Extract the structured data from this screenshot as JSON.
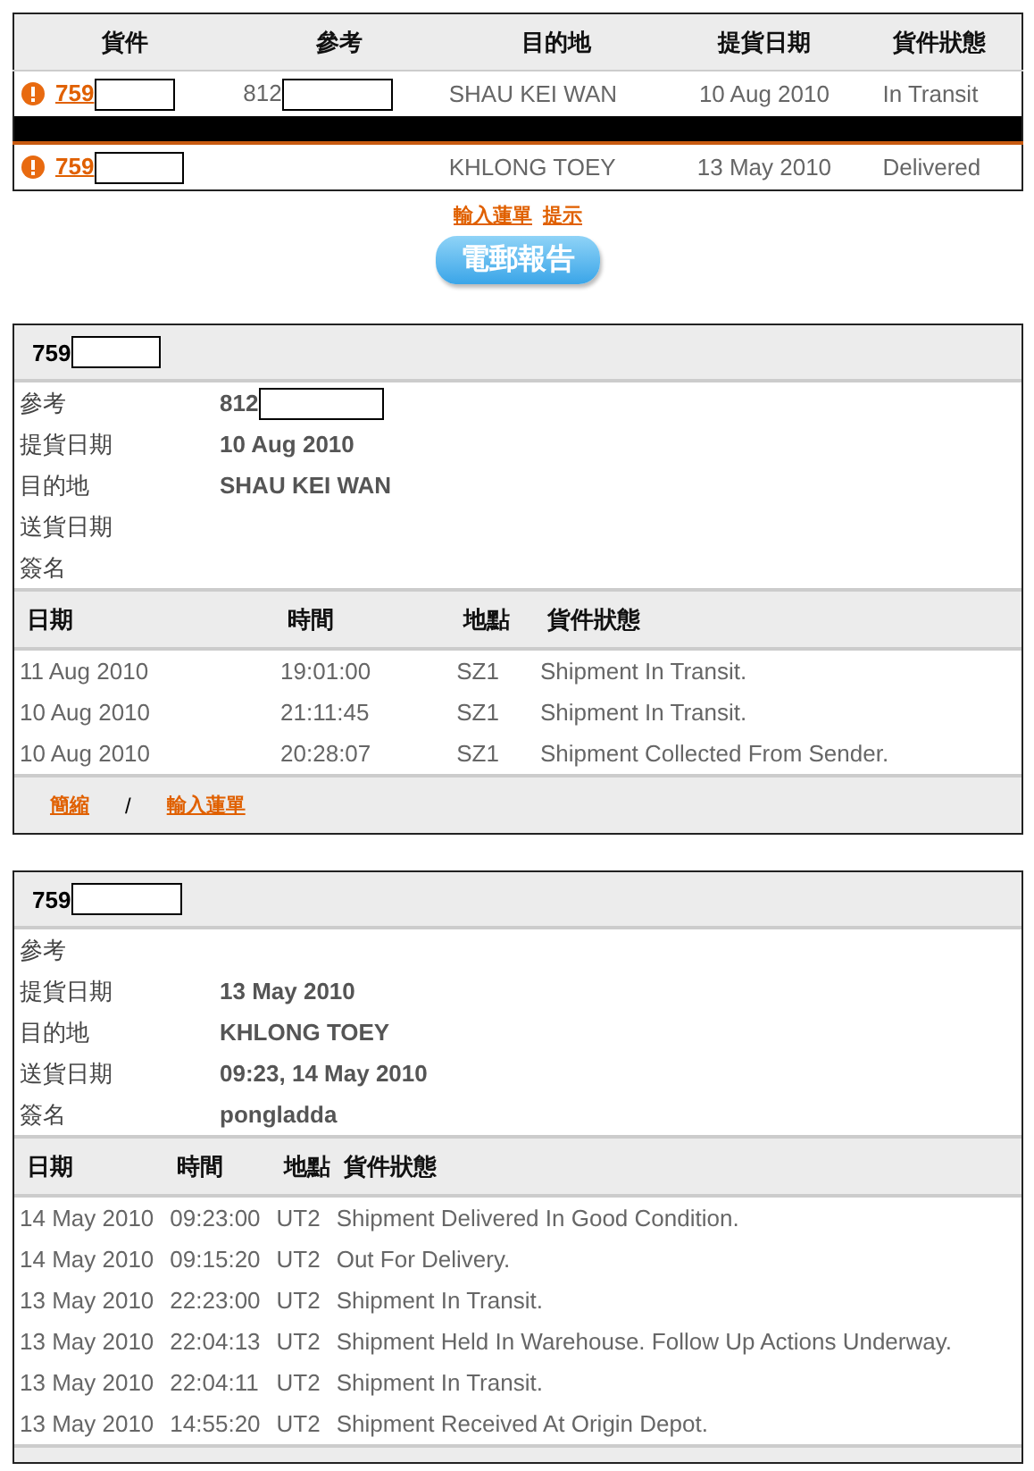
{
  "summary": {
    "columns": [
      "貨件",
      "參考",
      "目的地",
      "提貨日期",
      "貨件狀態"
    ],
    "rows": [
      {
        "alert": true,
        "shipment": "759",
        "shipment_redacted": true,
        "reference": "812",
        "reference_redacted": true,
        "destination": "SHAU KEI WAN",
        "pickup_date": "10 Aug 2010",
        "status": "In Transit"
      },
      {
        "alert": true,
        "shipment": "759",
        "shipment_redacted": true,
        "destination": "KHLONG TOEY",
        "pickup_date": "13 May 2010",
        "status": "Delivered"
      }
    ]
  },
  "links": [
    "輸入蓮單",
    "提示"
  ],
  "email_button": "電郵報告",
  "details": [
    {
      "shipment": "759",
      "shipment_redacted": true,
      "fields": [
        {
          "label": "參考",
          "value": "812",
          "redacted": true
        },
        {
          "label": "提貨日期",
          "value": "10 Aug 2010"
        },
        {
          "label": "目的地",
          "value": "SHAU KEI WAN"
        },
        {
          "label": "送貨日期"
        },
        {
          "label": "簽名"
        }
      ],
      "columns": [
        "日期",
        "時間",
        "地點",
        "貨件狀態"
      ],
      "events": [
        [
          "11 Aug 2010",
          "19:01:00",
          "SZ1",
          "Shipment In Transit."
        ],
        [
          "10 Aug 2010",
          "21:11:45",
          "SZ1",
          "Shipment In Transit."
        ],
        [
          "10 Aug 2010",
          "20:28:07",
          "SZ1",
          "Shipment Collected From Sender."
        ]
      ],
      "footer_links": [
        "簡縮",
        "/",
        "輸入蓮單"
      ]
    },
    {
      "shipment": "759",
      "shipment_redacted": true,
      "fields": [
        {
          "label": "參考"
        },
        {
          "label": "提貨日期",
          "value": "13 May 2010"
        },
        {
          "label": "目的地",
          "value": "KHLONG TOEY"
        },
        {
          "label": "送貨日期",
          "value": "09:23, 14 May 2010"
        },
        {
          "label": "簽名",
          "value": "pongladda"
        }
      ],
      "columns": [
        "日期",
        "時間",
        "地點",
        "貨件狀態"
      ],
      "events": [
        [
          "14 May 2010",
          "09:23:00",
          "UT2",
          "Shipment Delivered In Good Condition."
        ],
        [
          "14 May 2010",
          "09:15:20",
          "UT2",
          "Out For Delivery."
        ],
        [
          "13 May 2010",
          "22:23:00",
          "UT2",
          "Shipment In Transit."
        ],
        [
          "13 May 2010",
          "22:04:13",
          "UT2",
          "Shipment Held In Warehouse. Follow Up Actions Underway."
        ],
        [
          "13 May 2010",
          "22:04:11",
          "UT2",
          "Shipment In Transit."
        ],
        [
          "13 May 2010",
          "14:55:20",
          "UT2",
          "Shipment Received At Origin Depot."
        ]
      ]
    }
  ]
}
